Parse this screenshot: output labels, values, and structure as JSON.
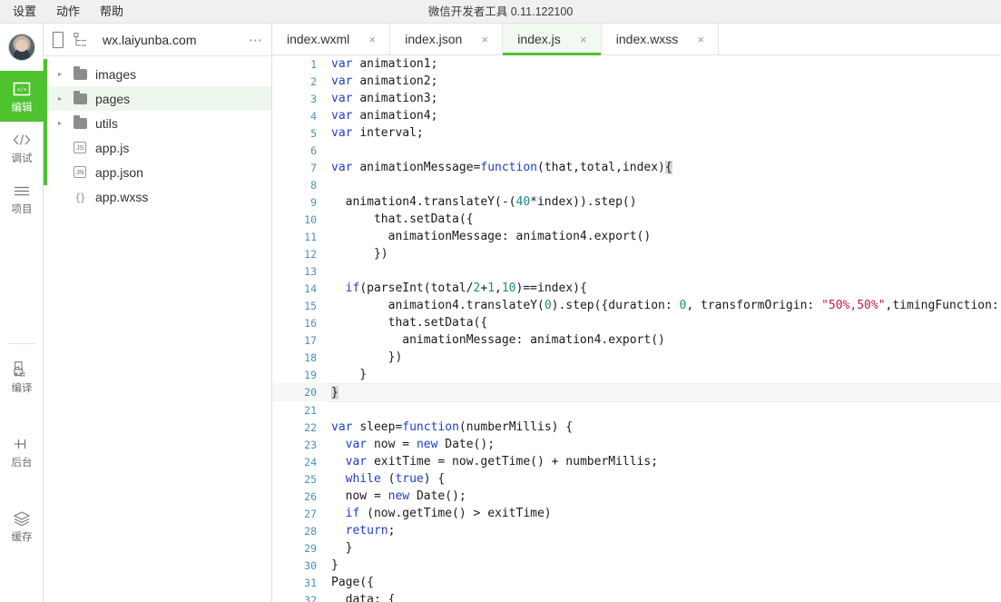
{
  "window": {
    "title": "微信开发者工具 0.11.122100"
  },
  "menubar": {
    "items": [
      {
        "label": "设置"
      },
      {
        "label": "动作"
      },
      {
        "label": "帮助"
      }
    ]
  },
  "rail": {
    "items": [
      {
        "label": "编辑",
        "icon": "code-box-icon",
        "active": true
      },
      {
        "label": "调试",
        "icon": "angle-brackets-icon",
        "active": false
      },
      {
        "label": "项目",
        "icon": "list-lines-icon",
        "active": false
      },
      {
        "label": "编译",
        "icon": "build-refresh-icon",
        "active": false
      },
      {
        "label": "后台",
        "icon": "background-bars-icon",
        "active": false
      },
      {
        "label": "缓存",
        "icon": "layers-icon",
        "active": false
      }
    ],
    "avatar_name": "user-avatar"
  },
  "filepanel": {
    "device_icon": "phone-icon",
    "tree_icon": "tree-structure-icon",
    "domain": "wx.laiyunba.com",
    "more_label": "⋯",
    "tree": [
      {
        "label": "images",
        "type": "folder",
        "icon": "folder-icon",
        "selected": false,
        "twisty": "▸"
      },
      {
        "label": "pages",
        "type": "folder",
        "icon": "folder-icon",
        "selected": true,
        "twisty": "▸"
      },
      {
        "label": "utils",
        "type": "folder",
        "icon": "folder-icon",
        "selected": false,
        "twisty": "▸"
      },
      {
        "label": "app.js",
        "type": "file",
        "icon": "js-file-icon",
        "badge": "JS",
        "selected": false
      },
      {
        "label": "app.json",
        "type": "file",
        "icon": "json-file-icon",
        "badge": "JN",
        "selected": false
      },
      {
        "label": "app.wxss",
        "type": "file",
        "icon": "wxss-file-icon",
        "badge": "{ }",
        "selected": false
      }
    ]
  },
  "editor": {
    "tabs": [
      {
        "label": "index.wxml",
        "active": false,
        "close": "×"
      },
      {
        "label": "index.json",
        "active": false,
        "close": "×"
      },
      {
        "label": "index.js",
        "active": true,
        "close": "×"
      },
      {
        "label": "index.wxss",
        "active": false,
        "close": "×"
      }
    ],
    "current_line": 20,
    "lines": [
      {
        "n": 1,
        "tokens": [
          {
            "t": "var ",
            "c": "kw"
          },
          {
            "t": "animation1;",
            "c": ""
          }
        ]
      },
      {
        "n": 2,
        "tokens": [
          {
            "t": "var ",
            "c": "kw"
          },
          {
            "t": "animation2;",
            "c": ""
          }
        ]
      },
      {
        "n": 3,
        "tokens": [
          {
            "t": "var ",
            "c": "kw"
          },
          {
            "t": "animation3;",
            "c": ""
          }
        ]
      },
      {
        "n": 4,
        "tokens": [
          {
            "t": "var ",
            "c": "kw"
          },
          {
            "t": "animation4;",
            "c": ""
          }
        ]
      },
      {
        "n": 5,
        "tokens": [
          {
            "t": "var ",
            "c": "kw"
          },
          {
            "t": "interval;",
            "c": ""
          }
        ]
      },
      {
        "n": 6,
        "tokens": []
      },
      {
        "n": 7,
        "tokens": [
          {
            "t": "var ",
            "c": "kw"
          },
          {
            "t": "animationMessage=",
            "c": ""
          },
          {
            "t": "function",
            "c": "kw"
          },
          {
            "t": "(that,total,index)",
            "c": ""
          },
          {
            "t": "{",
            "c": "cur"
          }
        ]
      },
      {
        "n": 8,
        "tokens": []
      },
      {
        "n": 9,
        "tokens": [
          {
            "t": "  animation4.translateY(-(",
            "c": ""
          },
          {
            "t": "40",
            "c": "num"
          },
          {
            "t": "*index)).step()",
            "c": ""
          }
        ]
      },
      {
        "n": 10,
        "tokens": [
          {
            "t": "      that.setData({",
            "c": ""
          }
        ]
      },
      {
        "n": 11,
        "tokens": [
          {
            "t": "        animationMessage: animation4.export()",
            "c": ""
          }
        ]
      },
      {
        "n": 12,
        "tokens": [
          {
            "t": "      })",
            "c": ""
          }
        ]
      },
      {
        "n": 13,
        "tokens": []
      },
      {
        "n": 14,
        "tokens": [
          {
            "t": "  ",
            "c": ""
          },
          {
            "t": "if",
            "c": "kw"
          },
          {
            "t": "(parseInt(total/",
            "c": ""
          },
          {
            "t": "2",
            "c": "num"
          },
          {
            "t": "+",
            "c": ""
          },
          {
            "t": "1",
            "c": "num"
          },
          {
            "t": ",",
            "c": ""
          },
          {
            "t": "10",
            "c": "num"
          },
          {
            "t": ")==index){",
            "c": ""
          }
        ]
      },
      {
        "n": 15,
        "tokens": [
          {
            "t": "        animation4.translateY(",
            "c": ""
          },
          {
            "t": "0",
            "c": "num"
          },
          {
            "t": ").step({duration: ",
            "c": ""
          },
          {
            "t": "0",
            "c": "num"
          },
          {
            "t": ", transformOrigin: ",
            "c": ""
          },
          {
            "t": "\"50%,50%\"",
            "c": "str"
          },
          {
            "t": ",timingFunction: ",
            "c": ""
          },
          {
            "t": "'",
            "c": "str"
          }
        ]
      },
      {
        "n": 16,
        "tokens": [
          {
            "t": "        that.setData({",
            "c": ""
          }
        ]
      },
      {
        "n": 17,
        "tokens": [
          {
            "t": "          animationMessage: animation4.export()",
            "c": ""
          }
        ]
      },
      {
        "n": 18,
        "tokens": [
          {
            "t": "        })",
            "c": ""
          }
        ]
      },
      {
        "n": 19,
        "tokens": [
          {
            "t": "    }",
            "c": ""
          }
        ]
      },
      {
        "n": 20,
        "tokens": [
          {
            "t": "}",
            "c": "cur"
          }
        ]
      },
      {
        "n": 21,
        "tokens": []
      },
      {
        "n": 22,
        "tokens": [
          {
            "t": "var ",
            "c": "kw"
          },
          {
            "t": "sleep=",
            "c": ""
          },
          {
            "t": "function",
            "c": "kw"
          },
          {
            "t": "(numberMillis) {",
            "c": ""
          }
        ]
      },
      {
        "n": 23,
        "tokens": [
          {
            "t": "  ",
            "c": ""
          },
          {
            "t": "var ",
            "c": "kw"
          },
          {
            "t": "now = ",
            "c": ""
          },
          {
            "t": "new ",
            "c": "kw"
          },
          {
            "t": "Date();",
            "c": ""
          }
        ]
      },
      {
        "n": 24,
        "tokens": [
          {
            "t": "  ",
            "c": ""
          },
          {
            "t": "var ",
            "c": "kw"
          },
          {
            "t": "exitTime = now.getTime() + numberMillis;",
            "c": ""
          }
        ]
      },
      {
        "n": 25,
        "tokens": [
          {
            "t": "  ",
            "c": ""
          },
          {
            "t": "while ",
            "c": "kw"
          },
          {
            "t": "(",
            "c": ""
          },
          {
            "t": "true",
            "c": "kw"
          },
          {
            "t": ") {",
            "c": ""
          }
        ]
      },
      {
        "n": 26,
        "tokens": [
          {
            "t": "  now = ",
            "c": ""
          },
          {
            "t": "new ",
            "c": "kw"
          },
          {
            "t": "Date();",
            "c": ""
          }
        ]
      },
      {
        "n": 27,
        "tokens": [
          {
            "t": "  ",
            "c": ""
          },
          {
            "t": "if ",
            "c": "kw"
          },
          {
            "t": "(now.getTime() > exitTime)",
            "c": ""
          }
        ]
      },
      {
        "n": 28,
        "tokens": [
          {
            "t": "  ",
            "c": ""
          },
          {
            "t": "return",
            "c": "kw"
          },
          {
            "t": ";",
            "c": ""
          }
        ]
      },
      {
        "n": 29,
        "tokens": [
          {
            "t": "  }",
            "c": ""
          }
        ]
      },
      {
        "n": 30,
        "tokens": [
          {
            "t": "}",
            "c": ""
          }
        ]
      },
      {
        "n": 31,
        "tokens": [
          {
            "t": "Page({",
            "c": ""
          }
        ]
      },
      {
        "n": 32,
        "tokens": [
          {
            "t": "  data: {",
            "c": ""
          }
        ]
      }
    ]
  },
  "colors": {
    "accent_green": "#4ec22f",
    "selected_row": "#eef7ee",
    "active_tab_bg": "#f2f9f1",
    "keyword": "#1d3fcf",
    "number": "#1a8a8a",
    "string": "#c2185b",
    "line_number": "#4a90c2"
  }
}
